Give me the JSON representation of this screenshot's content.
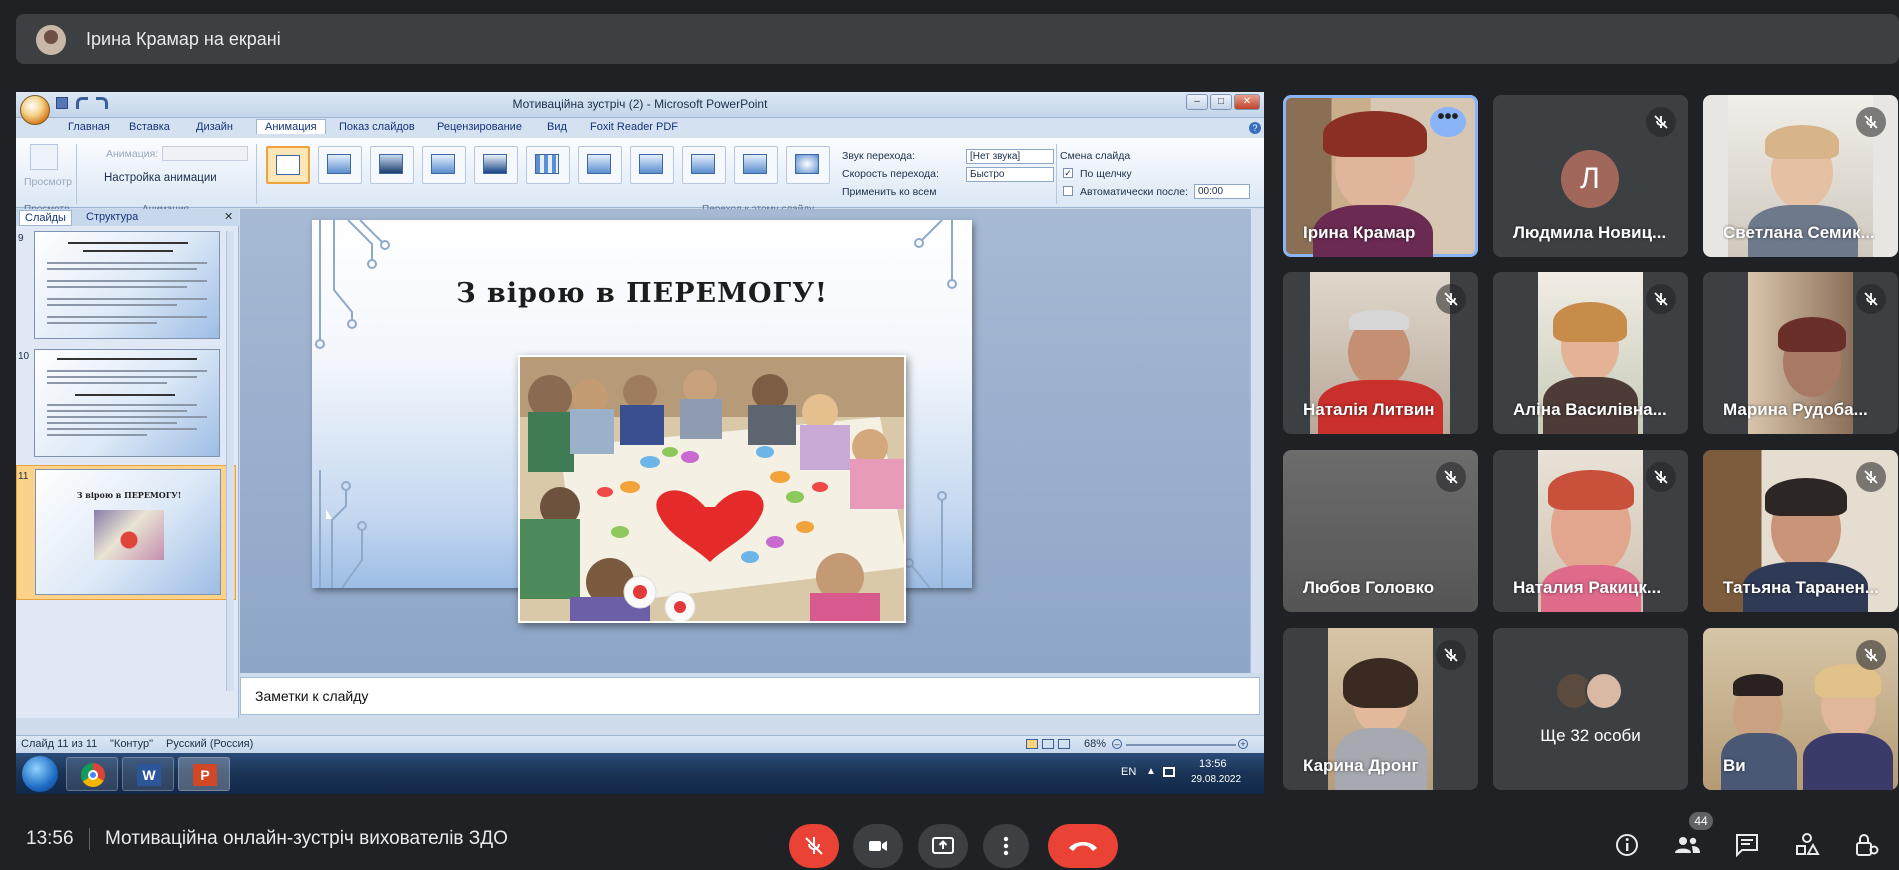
{
  "presenter_bar": {
    "text": "Ірина Крамар на екрані"
  },
  "ppt": {
    "window_title": "Мотиваційна зустріч (2) - Microsoft PowerPoint",
    "tabs": [
      "Главная",
      "Вставка",
      "Дизайн",
      "Анимация",
      "Показ слайдов",
      "Рецензирование",
      "Вид",
      "Foxit Reader PDF"
    ],
    "ribbon": {
      "preview": "Просмотр",
      "animation_label": "Анимация:",
      "custom_animation": "Настройка анимации",
      "group_preview": "Просмотр",
      "group_animation": "Анимация",
      "group_transition": "Переход к этому слайду",
      "sound_label": "Звук перехода:",
      "sound_value": "[Нет звука]",
      "speed_label": "Скорость перехода:",
      "speed_value": "Быстро",
      "apply_all": "Применить ко всем",
      "advance_title": "Смена слайда",
      "on_click": "По щелчку",
      "auto_after": "Автоматически после:",
      "auto_time": "00:00"
    },
    "panel_tabs": [
      "Слайды",
      "Структура"
    ],
    "thumbs": [
      {
        "num": "9"
      },
      {
        "num": "10"
      },
      {
        "num": "11",
        "title": "З вірою в ПЕРЕМОГУ!"
      }
    ],
    "slide_title": "З вірою в ПЕРЕМОГУ!",
    "notes_placeholder": "Заметки к слайду",
    "status": {
      "slide": "Слайд 11 из 11",
      "theme": "\"Контур\"",
      "lang": "Русский (Россия)",
      "zoom": "68%"
    },
    "tray": {
      "lang": "EN",
      "time": "13:56",
      "date": "29.08.2022"
    }
  },
  "participants": [
    {
      "name": "Ірина Крамар",
      "muted": false,
      "active": true
    },
    {
      "name": "Людмила Новиц...",
      "muted": true,
      "initial": "Л"
    },
    {
      "name": "Светлана Семик...",
      "muted": true
    },
    {
      "name": "Наталія Литвин",
      "muted": true
    },
    {
      "name": "Аліна Василівна...",
      "muted": true
    },
    {
      "name": "Марина Рудоба...",
      "muted": true
    },
    {
      "name": "Любов Головко",
      "muted": true
    },
    {
      "name": "Наталия Ракицк...",
      "muted": true
    },
    {
      "name": "Татьяна Таранен...",
      "muted": true
    },
    {
      "name": "Карина Дронг",
      "muted": true
    },
    {
      "name": "Ще 32 особи"
    },
    {
      "name": "Ви",
      "muted": true
    }
  ],
  "bottom": {
    "time": "13:56",
    "meeting_title": "Мотиваційна онлайн-зустріч вихователів ЗДО",
    "people_count": "44"
  },
  "colors": {
    "meet_bg": "#202124",
    "end_call_red": "#ea4335",
    "active_outline": "#8ab4f8"
  }
}
